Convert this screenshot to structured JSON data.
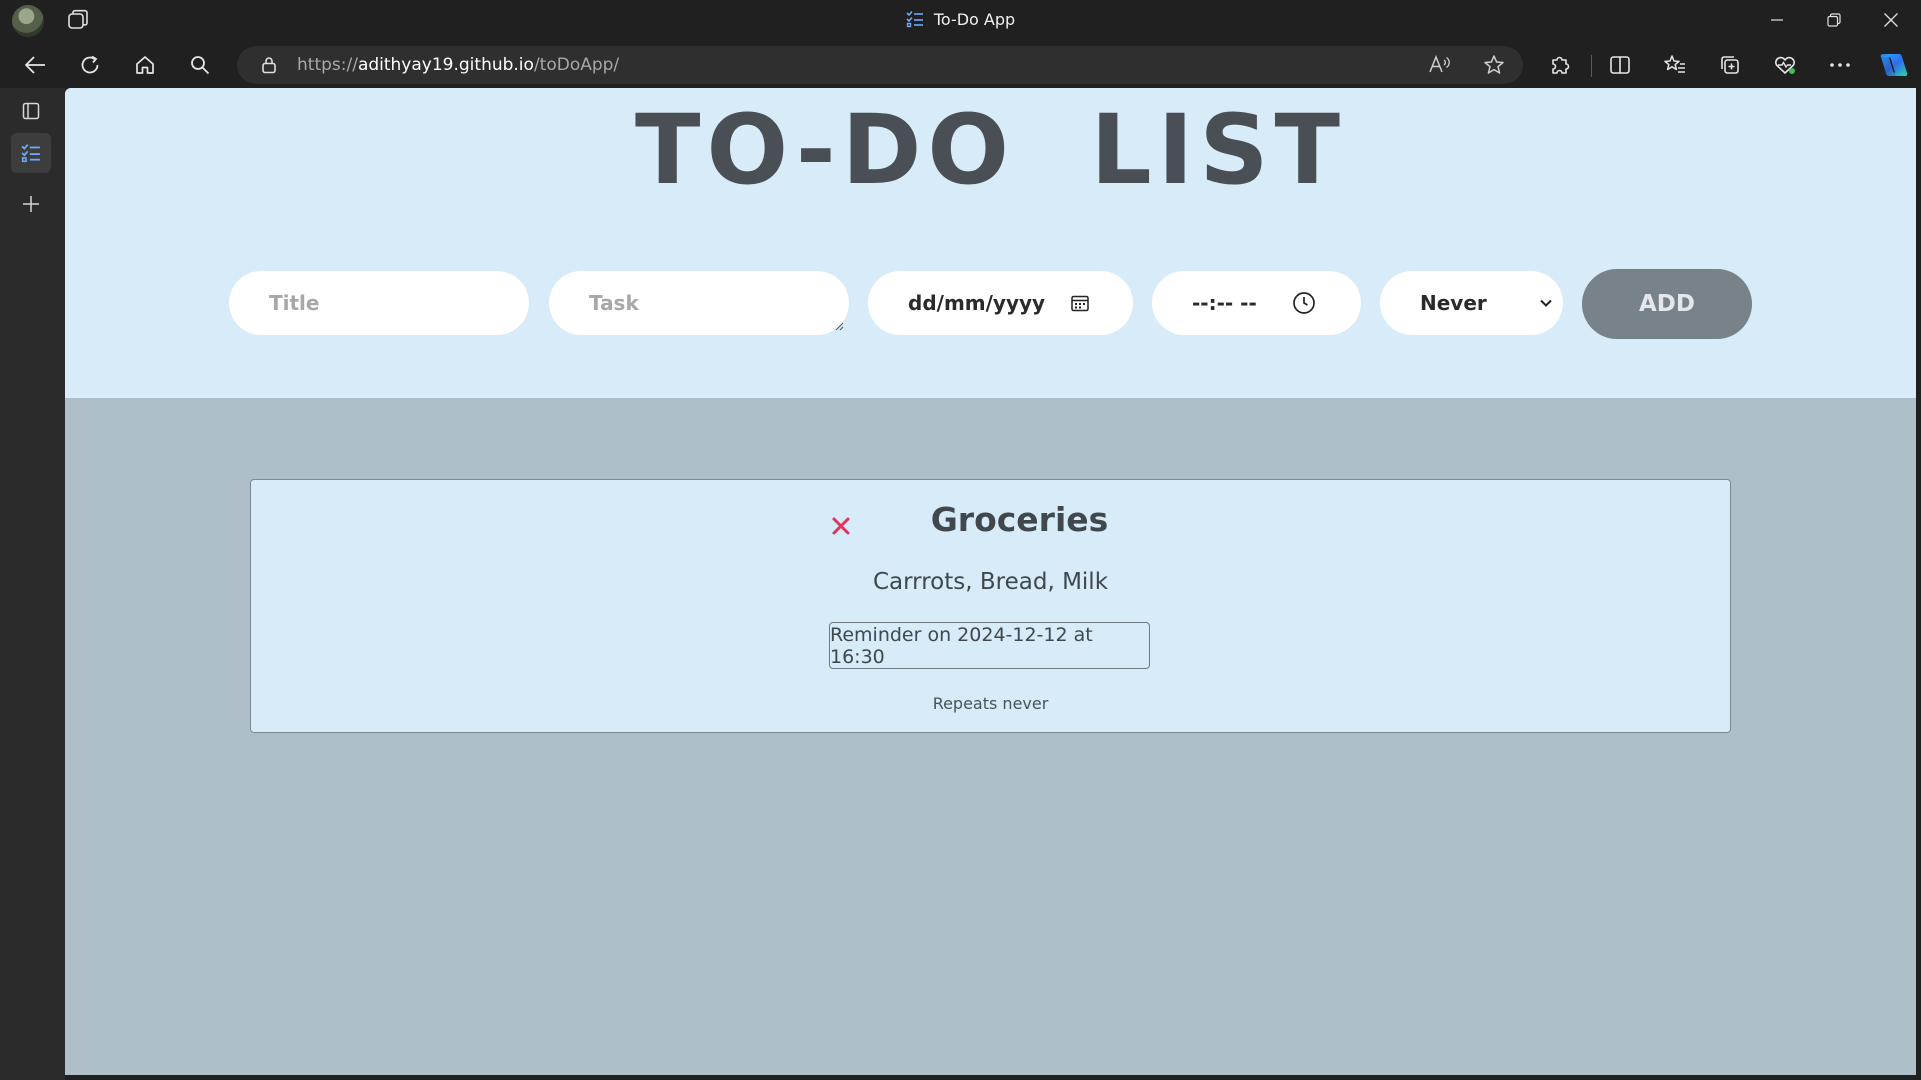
{
  "browser": {
    "tab_title": "To-Do App",
    "url_prefix": "https://",
    "url_host": "adithyay19.github.io",
    "url_path": "/toDoApp/"
  },
  "icons": {
    "workspaces": "workspaces-icon",
    "tab": "checklist-icon",
    "back": "back-arrow-icon",
    "refresh": "refresh-icon",
    "home": "home-icon",
    "search": "search-icon",
    "lock": "lock-icon",
    "read_aloud": "read-aloud-icon",
    "favorite": "star-icon",
    "extensions": "puzzle-icon",
    "split": "split-screen-icon",
    "favorites": "favorites-icon",
    "collections": "collections-icon",
    "health": "browser-essentials-icon",
    "more": "more-icon",
    "copilot": "copilot-icon"
  },
  "app": {
    "title": "TO-DO LIST",
    "form": {
      "title_placeholder": "Title",
      "task_placeholder": "Task",
      "date_placeholder": "dd/mm/yyyy",
      "time_placeholder": "--:-- --",
      "repeat_selected": "Never",
      "add_label": "ADD"
    },
    "tasks": [
      {
        "title": "Groceries",
        "description": "Carrrots, Bread, Milk",
        "reminder": "Reminder on 2024-12-12 at 16:30",
        "repeats": "Repeats never"
      }
    ]
  },
  "colors": {
    "header_bg": "#d7ebf8",
    "page_bg": "#aebfca",
    "add_button": "#778289",
    "delete_icon": "#e0345a"
  }
}
